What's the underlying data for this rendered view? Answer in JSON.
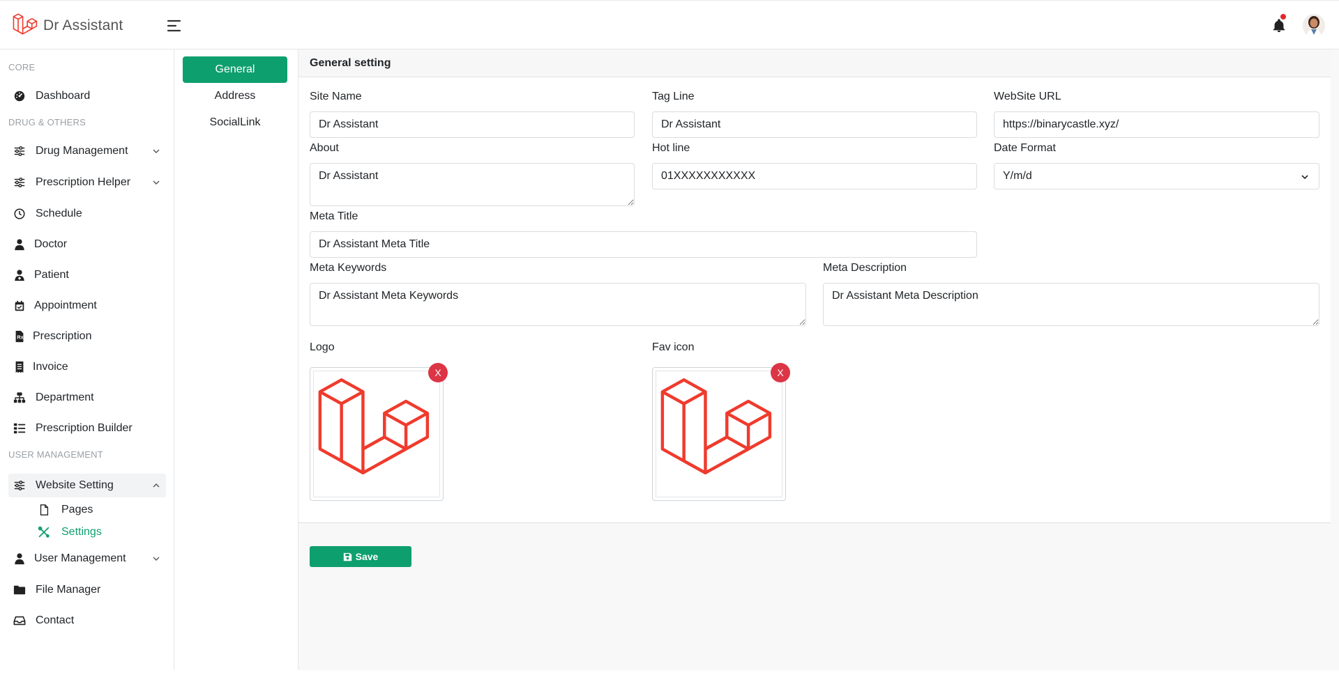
{
  "app": {
    "title": "Dr Assistant"
  },
  "colors": {
    "accent": "#0e9f6e",
    "danger": "#dc3545",
    "logo": "#ef3b2d"
  },
  "topbar": {
    "menu_icon": "hamburger-icon",
    "notification_icon": "bell-icon",
    "avatar": "user-avatar"
  },
  "sidebar": {
    "headings": {
      "core": "CORE",
      "drug": "DRUG & OTHERS",
      "user": "USER MANAGEMENT"
    },
    "items": {
      "dashboard": "Dashboard",
      "drug_management": "Drug Management",
      "prescription_helper": "Prescription Helper",
      "schedule": "Schedule",
      "doctor": "Doctor",
      "patient": "Patient",
      "appointment": "Appointment",
      "prescription": "Prescription",
      "invoice": "Invoice",
      "department": "Department",
      "prescription_builder": "Prescription Builder",
      "website_setting": "Website Setting",
      "pages": "Pages",
      "settings": "Settings",
      "user_management": "User Management",
      "file_manager": "File Manager",
      "contact": "Contact"
    }
  },
  "tabs": {
    "general": "General",
    "address": "Address",
    "social": "SocialLink"
  },
  "form": {
    "title": "General setting",
    "site_name": {
      "label": "Site Name",
      "value": "Dr Assistant"
    },
    "tag_line": {
      "label": "Tag Line",
      "value": "Dr Assistant"
    },
    "website_url": {
      "label": "WebSite URL",
      "value": "https://binarycastle.xyz/"
    },
    "about": {
      "label": "About",
      "value": "Dr Assistant"
    },
    "hot_line": {
      "label": "Hot line",
      "value": "01XXXXXXXXXXX"
    },
    "date_format": {
      "label": "Date Format",
      "value": "Y/m/d"
    },
    "meta_title": {
      "label": "Meta Title",
      "value": "Dr Assistant Meta Title"
    },
    "meta_keywords": {
      "label": "Meta Keywords",
      "value": "Dr Assistant Meta Keywords"
    },
    "meta_description": {
      "label": "Meta Description",
      "value": "Dr Assistant Meta Description"
    },
    "logo": {
      "label": "Logo",
      "remove": "X"
    },
    "fav_icon": {
      "label": "Fav icon",
      "remove": "X"
    },
    "save": "Save"
  }
}
